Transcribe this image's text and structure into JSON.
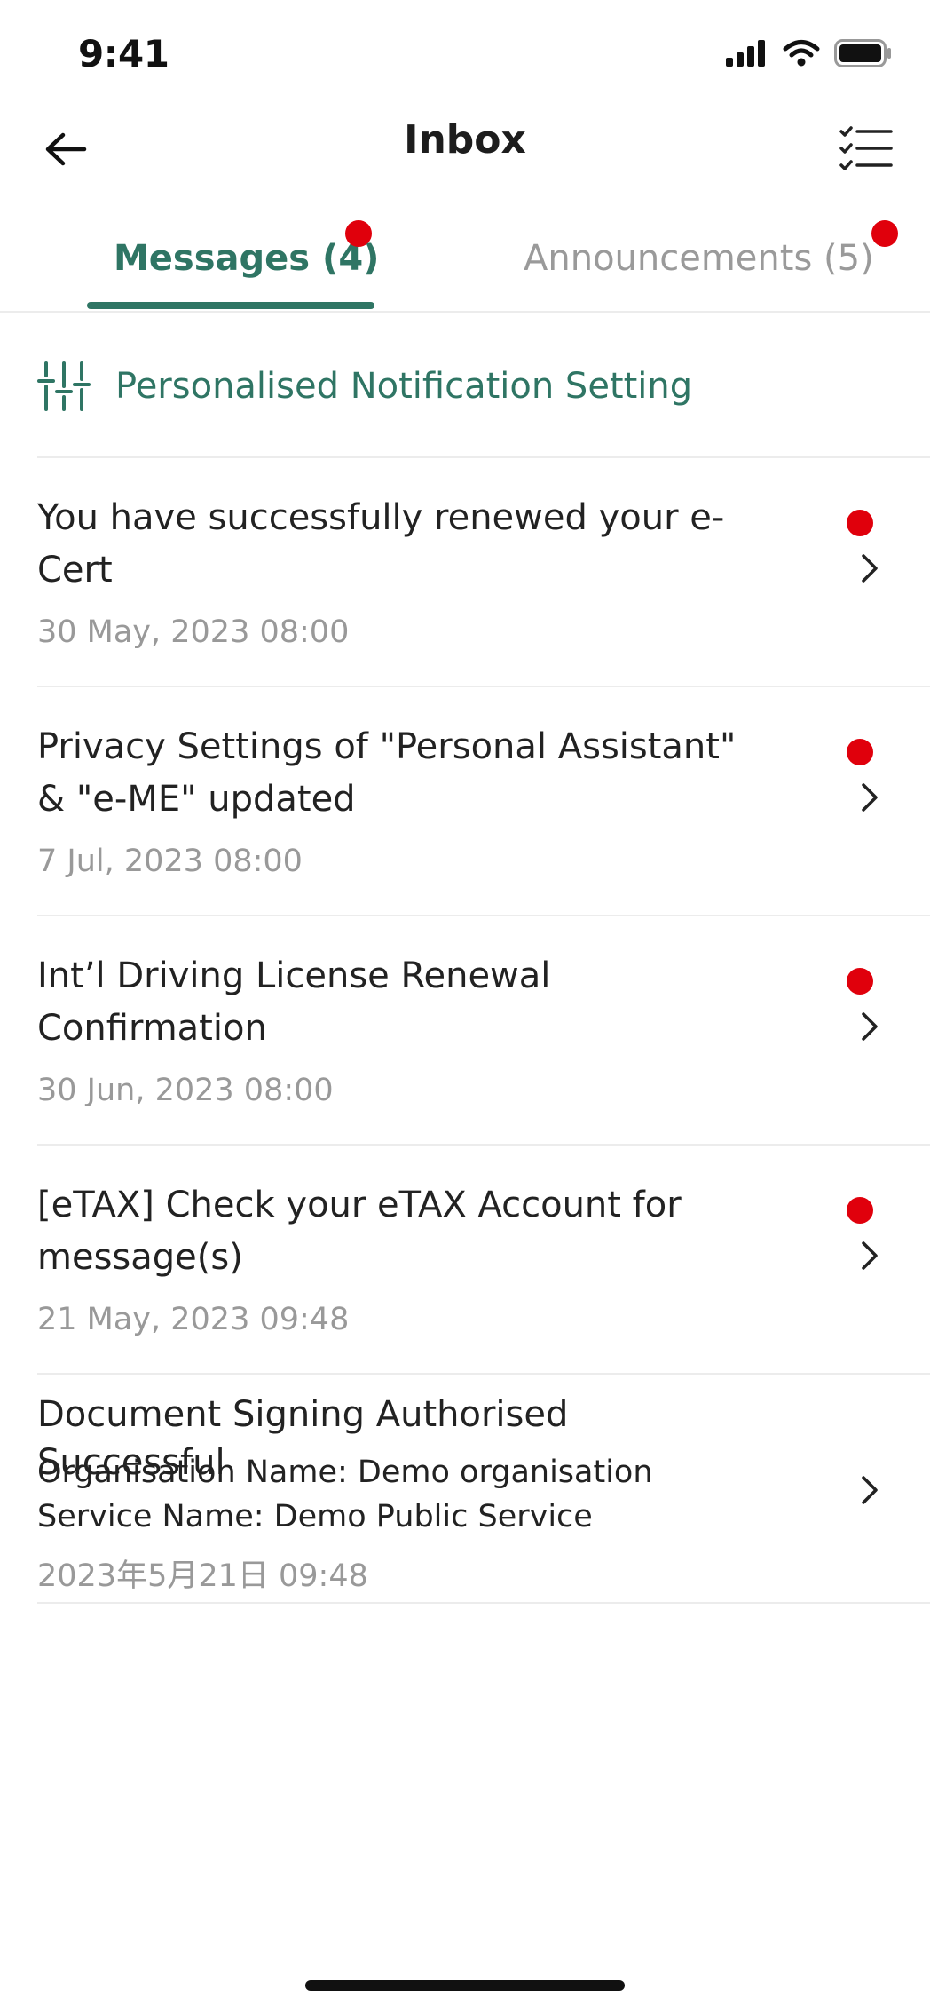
{
  "status_bar": {
    "time": "9:41",
    "icons": [
      "signal-icon",
      "wifi-icon",
      "battery-icon"
    ]
  },
  "header": {
    "title": "Inbox",
    "back_icon": "arrow-left-icon",
    "list_icon": "checklist-icon"
  },
  "tabs": [
    {
      "label": "Messages (4)",
      "active": true,
      "has_unread_dot": true
    },
    {
      "label": "Announcements (5)",
      "active": false,
      "has_unread_dot": true
    }
  ],
  "notification_setting": {
    "icon": "sliders-icon",
    "label": "Personalised Notification Setting"
  },
  "messages": [
    {
      "title": "You have successfully renewed your e-Cert",
      "date": "30 May, 2023 08:00",
      "unread": true
    },
    {
      "title": "Privacy Settings of \"Personal Assistant\" & \"e-ME\"  updated",
      "date": "7 Jul, 2023 08:00",
      "unread": true
    },
    {
      "title": "Int’l Driving License Renewal Confirmation",
      "date": "30 Jun, 2023 08:00",
      "unread": true
    },
    {
      "title": "[eTAX] Check your eTAX Account for message(s)",
      "date": "21 May, 2023 09:48",
      "unread": true
    },
    {
      "title": "Document Signing Authorised Successful",
      "organisation": "Organisation Name: Demo organisation",
      "service": "Service Name: Demo Public Service",
      "date": "2023年5月21日 09:48",
      "unread": false
    }
  ],
  "colors": {
    "accent": "#2f7564",
    "unread_dot": "#e0000c",
    "muted_text": "#999999",
    "divider": "#ececec"
  }
}
